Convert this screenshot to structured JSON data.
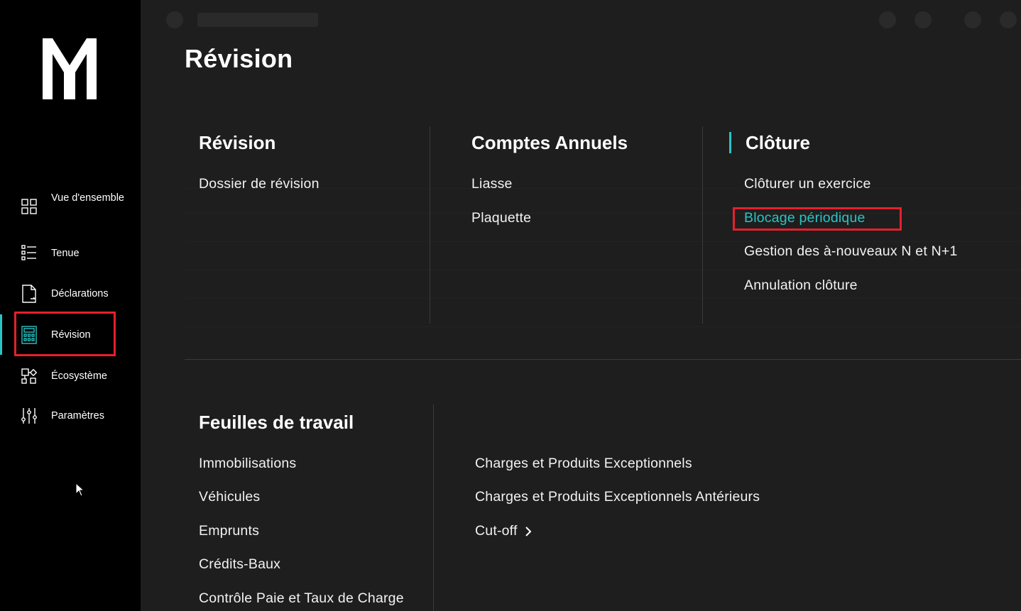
{
  "sidebar": {
    "logo": "M",
    "items": [
      {
        "label": "Vue d'ensemble",
        "icon": "grid-icon"
      },
      {
        "label": "Tenue",
        "icon": "list-icon"
      },
      {
        "label": "Déclarations",
        "icon": "document-icon"
      },
      {
        "label": "Révision",
        "icon": "calculator-icon"
      },
      {
        "label": "Écosystème",
        "icon": "ecosystem-icon"
      },
      {
        "label": "Paramètres",
        "icon": "sliders-icon"
      }
    ],
    "active_index": 3
  },
  "main": {
    "title": "Révision",
    "menu": {
      "revision": {
        "heading": "Révision",
        "links": [
          "Dossier de révision"
        ]
      },
      "comptes_annuels": {
        "heading": "Comptes Annuels",
        "links": [
          "Liasse",
          "Plaquette"
        ]
      },
      "cloture": {
        "heading": "Clôture",
        "links": [
          "Clôturer un exercice",
          "Blocage périodique",
          "Gestion des à-nouveaux N et N+1",
          "Annulation clôture"
        ],
        "highlighted_index": 1
      },
      "feuilles": {
        "heading": "Feuilles de travail",
        "links_left": [
          "Immobilisations",
          "Véhicules",
          "Emprunts",
          "Crédits-Baux",
          "Contrôle Paie et Taux de Charge"
        ],
        "links_right": [
          "Charges et Produits Exceptionnels",
          "Charges et Produits Exceptionnels Antérieurs",
          "Cut-off"
        ]
      }
    }
  },
  "colors": {
    "accent": "#2bc4c4",
    "highlight": "#e5202c",
    "background": "#1e1e1e",
    "sidebar": "#000000"
  }
}
